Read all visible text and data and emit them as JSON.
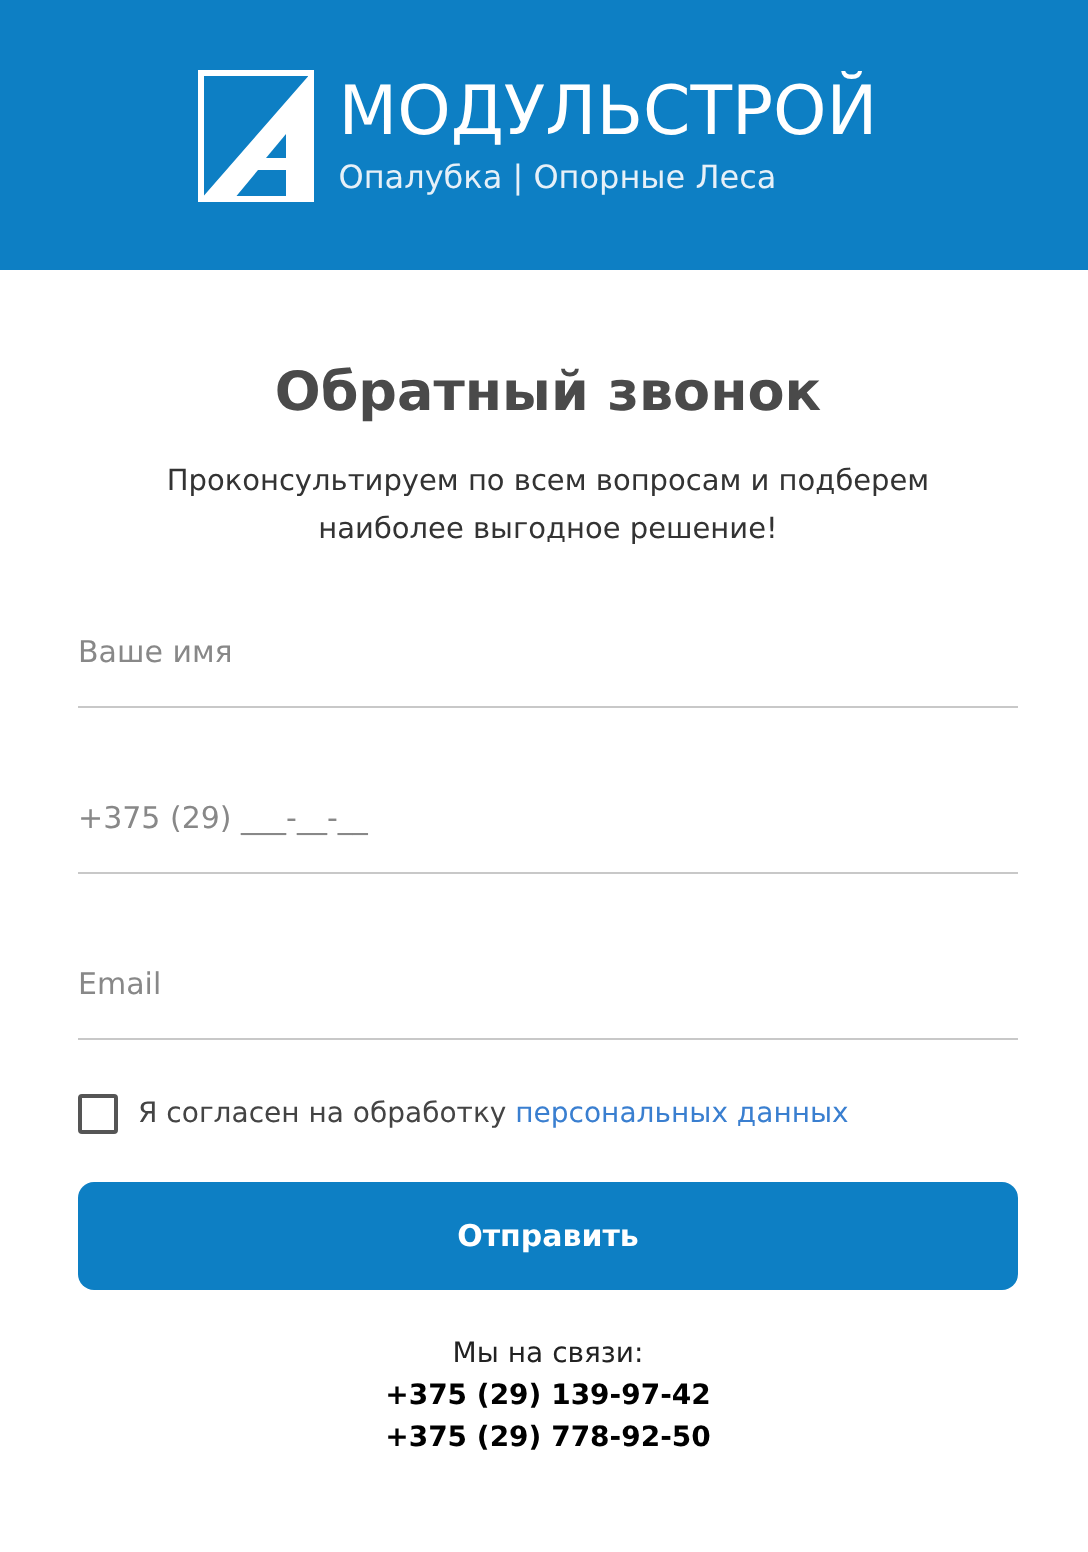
{
  "header": {
    "brand": "МОДУЛЬСТРОЙ",
    "tagline": "Опалубка | Опорные Леса"
  },
  "form": {
    "title": "Обратный звонок",
    "subtitle": "Проконсультируем по всем вопросам и подберем наиболее выгодное решение!",
    "fields": [
      {
        "placeholder": "Ваше имя"
      },
      {
        "placeholder": "+375 (29) ___-__-__"
      },
      {
        "placeholder": "Email"
      }
    ],
    "consent": {
      "checked": false,
      "text": "Я согласен на обработку",
      "link": "персональных данных"
    },
    "submit": "Отправить"
  },
  "contacts": {
    "label": "Мы на связи:",
    "phones": [
      "+375 (29) 139-97-42",
      "+375 (29) 778-92-50"
    ]
  }
}
